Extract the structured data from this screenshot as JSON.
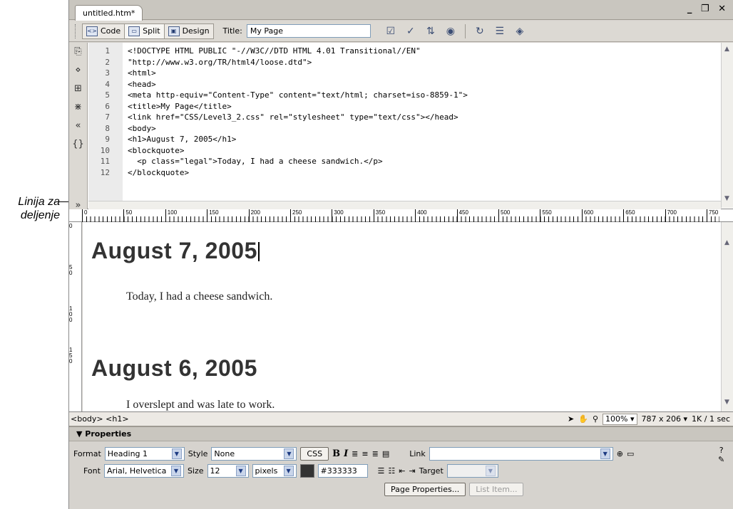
{
  "callout": {
    "line1": "Linija za",
    "line2": "deljenje"
  },
  "document_tab": {
    "label": "untitled.htm*"
  },
  "window_controls": {
    "minimize": "_",
    "restore": "❐",
    "close": "✕"
  },
  "toolbar": {
    "code_label": "Code",
    "split_label": "Split",
    "design_label": "Design",
    "title_label": "Title:",
    "title_value": "My Page"
  },
  "code": {
    "line_numbers": [
      "1",
      "2",
      "3",
      "4",
      "5",
      "6",
      "7",
      "8",
      "9",
      "10",
      "11",
      "12"
    ],
    "lines": [
      "<!DOCTYPE HTML PUBLIC \"-//W3C//DTD HTML 4.01 Transitional//EN\"",
      "\"http://www.w3.org/TR/html4/loose.dtd\">",
      "<html>",
      "<head>",
      "<meta http-equiv=\"Content-Type\" content=\"text/html; charset=iso-8859-1\">",
      "<title>My Page</title>",
      "<link href=\"CSS/Level3_2.css\" rel=\"stylesheet\" type=\"text/css\"></head>",
      "<body>",
      "<h1>August 7, 2005</h1>",
      "<blockquote>",
      "  <p class=\"legal\">Today, I had a cheese sandwich.</p>",
      "</blockquote>"
    ]
  },
  "ruler": {
    "marks": [
      "0",
      "50",
      "100",
      "150",
      "200",
      "250",
      "300",
      "350",
      "400",
      "450",
      "500",
      "550",
      "600",
      "650",
      "700",
      "750"
    ]
  },
  "vruler": {
    "marks": [
      "0",
      "5\n0",
      "1\n0\n0",
      "1\n5\n0"
    ]
  },
  "design": {
    "heading1": "August 7, 2005",
    "para1": "Today, I had a cheese sandwich.",
    "heading2": "August 6, 2005",
    "para2": "I overslept and was late to work."
  },
  "statusbar": {
    "tag_selector": "<body> <h1>",
    "zoom": "100%",
    "window_size": "787 x 206",
    "download": "1K / 1 sec"
  },
  "properties": {
    "title": "Properties",
    "format_label": "Format",
    "format_value": "Heading 1",
    "style_label": "Style",
    "style_value": "None",
    "css_button": "CSS",
    "bold": "B",
    "italic": "I",
    "link_label": "Link",
    "link_value": "",
    "font_label": "Font",
    "font_value": "Arial, Helvetica",
    "size_label": "Size",
    "size_value": "12",
    "unit_value": "pixels",
    "color_value": "#333333",
    "target_label": "Target",
    "page_properties_button": "Page Properties...",
    "list_item_button": "List Item..."
  }
}
